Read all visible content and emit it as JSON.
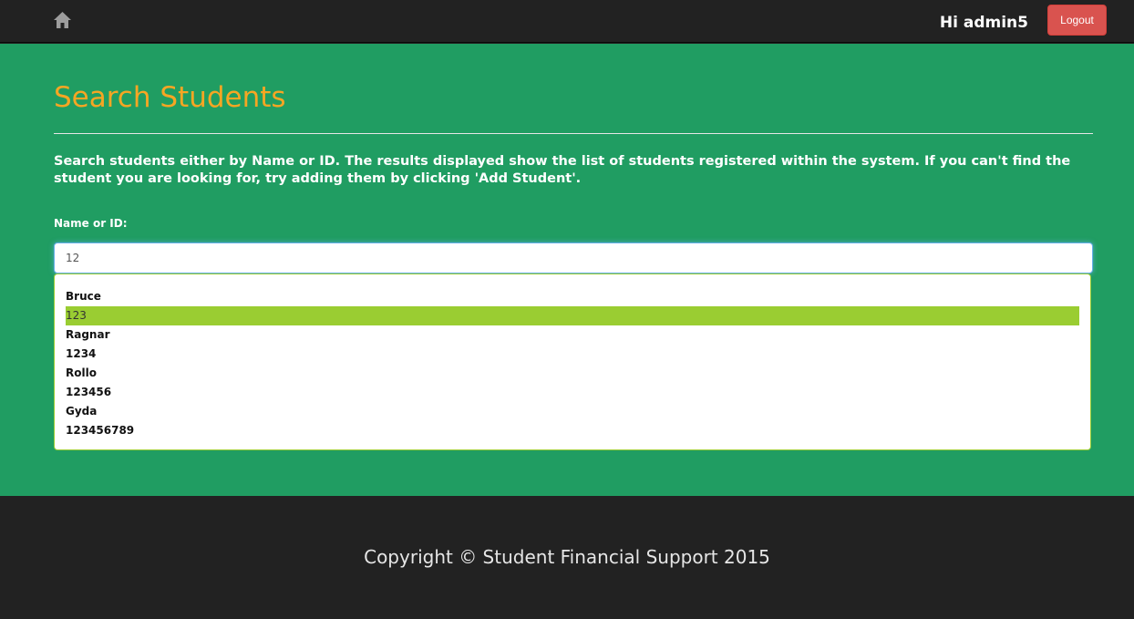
{
  "nav": {
    "home_icon": "home-icon",
    "greeting": "Hi admin5",
    "logout_label": "Logout"
  },
  "main": {
    "title": "Search Students",
    "intro": "Search students either by Name or ID. The results displayed show the list of students registered within the system. If you can't find the student you are looking for, try adding them by clicking 'Add Student'.",
    "field_label": "Name or ID:",
    "search_value": "12",
    "suggestions": [
      "Bruce",
      "123",
      "Ragnar",
      "1234",
      "Rollo",
      "123456",
      "Gyda",
      "123456789"
    ],
    "active_suggestion": "123"
  },
  "footer": {
    "copyright": "Copyright © Student Financial Support 2015"
  },
  "colors": {
    "navbar_bg": "#222222",
    "main_bg": "#209d62",
    "title": "#f6a623",
    "logout": "#d9534f",
    "highlight": "#9acd32"
  }
}
